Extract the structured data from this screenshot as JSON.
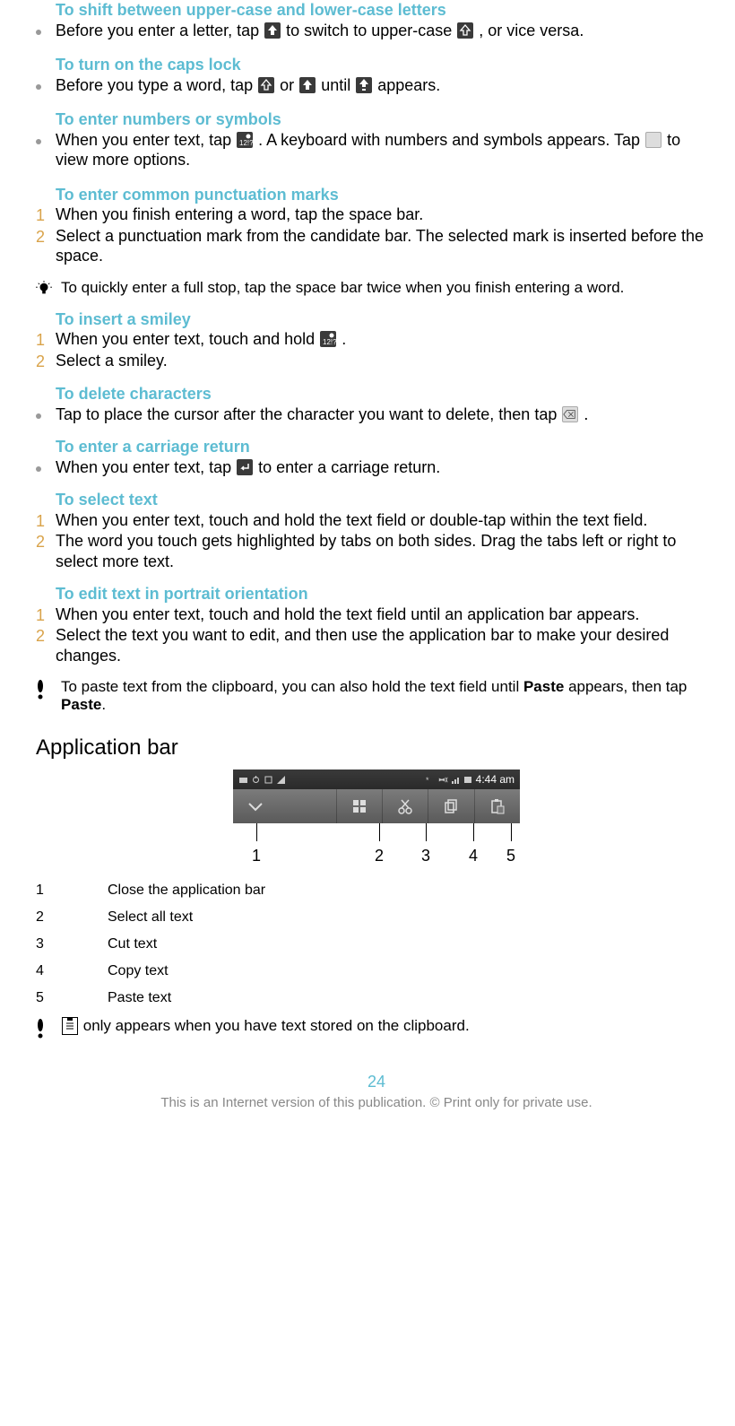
{
  "sections": {
    "shift_case": {
      "heading": "To shift between upper-case and lower-case letters",
      "bullet_a": "Before you enter a letter, tap ",
      "bullet_b": " to switch to upper-case ",
      "bullet_c": ", or vice versa."
    },
    "caps_lock": {
      "heading": "To turn on the caps lock",
      "bullet_a": "Before you type a word, tap ",
      "bullet_b": " or ",
      "bullet_c": " until ",
      "bullet_d": " appears."
    },
    "numbers": {
      "heading": "To enter numbers or symbols",
      "bullet_a": "When you enter text, tap ",
      "bullet_b": ". A keyboard with numbers and symbols appears. Tap ",
      "bullet_c": " to view more options."
    },
    "punctuation": {
      "heading": "To enter common punctuation marks",
      "step1": "When you finish entering a word, tap the space bar.",
      "step2": "Select a punctuation mark from the candidate bar. The selected mark is inserted before the space.",
      "tip": "To quickly enter a full stop, tap the space bar twice when you finish entering a word."
    },
    "smiley": {
      "heading": "To insert a smiley",
      "step1_a": "When you enter text, touch and hold ",
      "step1_b": ".",
      "step2": "Select a smiley."
    },
    "delete": {
      "heading": "To delete characters",
      "bullet_a": "Tap to place the cursor after the character you want to delete, then tap ",
      "bullet_b": "."
    },
    "carriage": {
      "heading": "To enter a carriage return",
      "bullet_a": "When you enter text, tap ",
      "bullet_b": " to enter a carriage return."
    },
    "select": {
      "heading": "To select text",
      "step1": "When you enter text, touch and hold the text field or double-tap within the text field.",
      "step2": "The word you touch gets highlighted by tabs on both sides. Drag the tabs left or right to select more text."
    },
    "edit": {
      "heading": "To edit text in portrait orientation",
      "step1": "When you enter text, touch and hold the text field until an application bar appears.",
      "step2": "Select the text you want to edit, and then use the application bar to make your desired changes.",
      "note_a": "To paste text from the clipboard, you can also hold the text field until ",
      "note_b": "Paste",
      "note_c": " appears, then tap ",
      "note_d": "Paste",
      "note_e": "."
    }
  },
  "appbar": {
    "heading": "Application bar",
    "time": "4:44 am",
    "callouts": {
      "n1": "1",
      "n2": "2",
      "n3": "3",
      "n4": "4",
      "n5": "5"
    },
    "legend": {
      "1": "Close the application bar",
      "2": "Select all text",
      "3": "Cut text",
      "4": "Copy text",
      "5": "Paste text"
    },
    "note": " only appears when you have text stored on the clipboard."
  },
  "page_number": "24",
  "footer": "This is an Internet version of this publication. © Print only for private use."
}
